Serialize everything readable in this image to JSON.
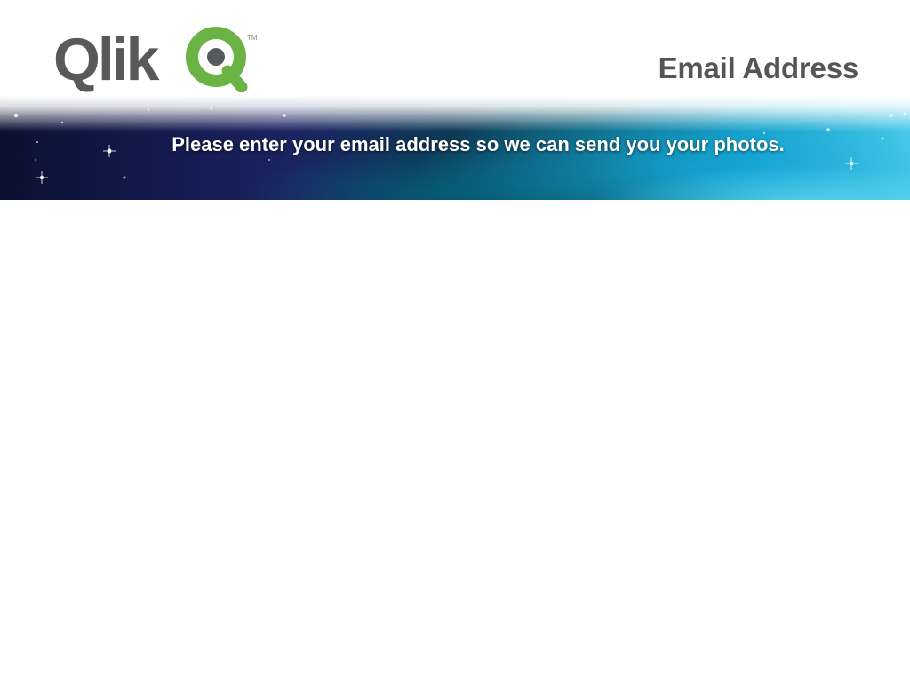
{
  "header": {
    "logo": {
      "brand_text": "Qlik",
      "mark_letter": "Q",
      "trademark": "TM",
      "icon": "qlik-logo-icon",
      "text_color": "#58595b",
      "accent_color": "#6ab344"
    },
    "page_title": "Email Address"
  },
  "banner": {
    "message": "Please enter your email address so we can send you your photos.",
    "colors": {
      "left": "#0b1030",
      "middle": "#0e6078",
      "right": "#48c9ea"
    }
  }
}
